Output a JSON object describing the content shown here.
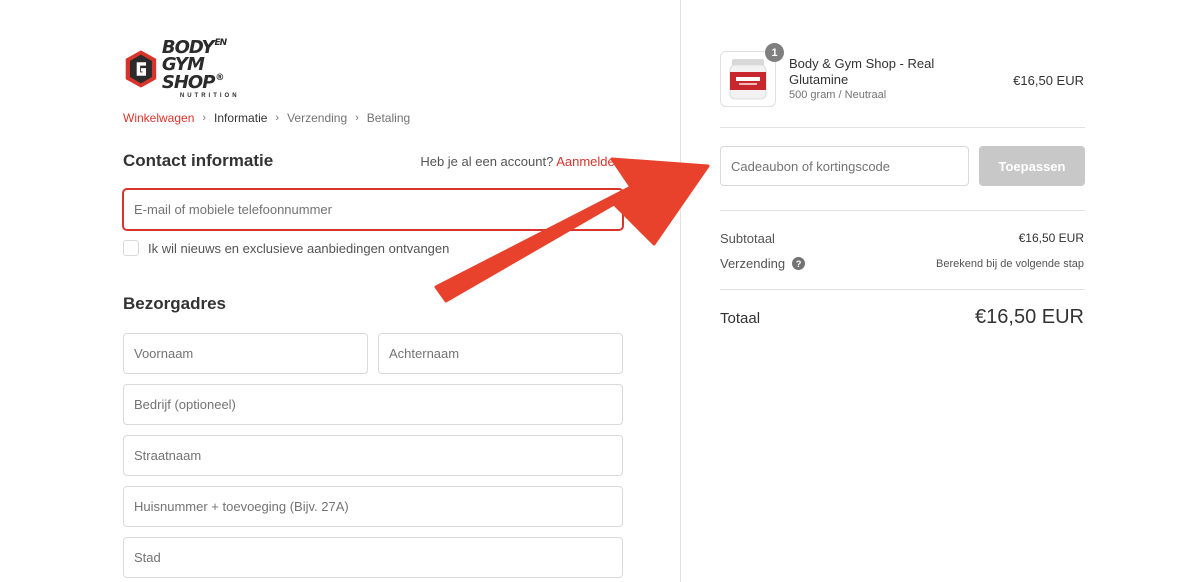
{
  "logo": {
    "line1": "BODY",
    "line1_small": "EN",
    "line2": "GYM SHOP",
    "registered": "®",
    "line3": "NUTRITION",
    "brand_color": "#d9342b"
  },
  "breadcrumb": {
    "items": [
      "Winkelwagen",
      "Informatie",
      "Verzending",
      "Betaling"
    ],
    "separator": "›"
  },
  "contact": {
    "title": "Contact informatie",
    "account_prompt": "Heb je al een account?",
    "login_link": "Aanmelden",
    "email_placeholder": "E-mail of mobiele telefoonnummer",
    "newsletter_label": "Ik wil nieuws en exclusieve aanbiedingen ontvangen"
  },
  "delivery": {
    "title": "Bezorgadres",
    "first_name_placeholder": "Voornaam",
    "last_name_placeholder": "Achternaam",
    "company_placeholder": "Bedrijf (optioneel)",
    "street_placeholder": "Straatnaam",
    "house_number_placeholder": "Huisnummer + toevoeging (Bijv. 27A)",
    "city_placeholder": "Stad"
  },
  "order": {
    "quantity": "1",
    "product_name": "Body & Gym Shop - Real Glutamine",
    "product_variant": "500 gram / Neutraal",
    "product_price": "€16,50 EUR",
    "discount_placeholder": "Cadeaubon of kortingscode",
    "apply_label": "Toepassen",
    "subtotal_label": "Subtotaal",
    "subtotal_value": "€16,50 EUR",
    "shipping_label": "Verzending",
    "shipping_help": "?",
    "shipping_value": "Berekend bij de volgende stap",
    "total_label": "Totaal",
    "total_value": "€16,50 EUR"
  },
  "colors": {
    "accent": "#d9342b",
    "arrow": "#e8412c",
    "button_disabled": "#c8c8c8"
  },
  "icons": {
    "breadcrumb_separator": "chevron-right-icon",
    "help": "question-circle-icon",
    "annotation": "arrow-annotation-icon"
  }
}
